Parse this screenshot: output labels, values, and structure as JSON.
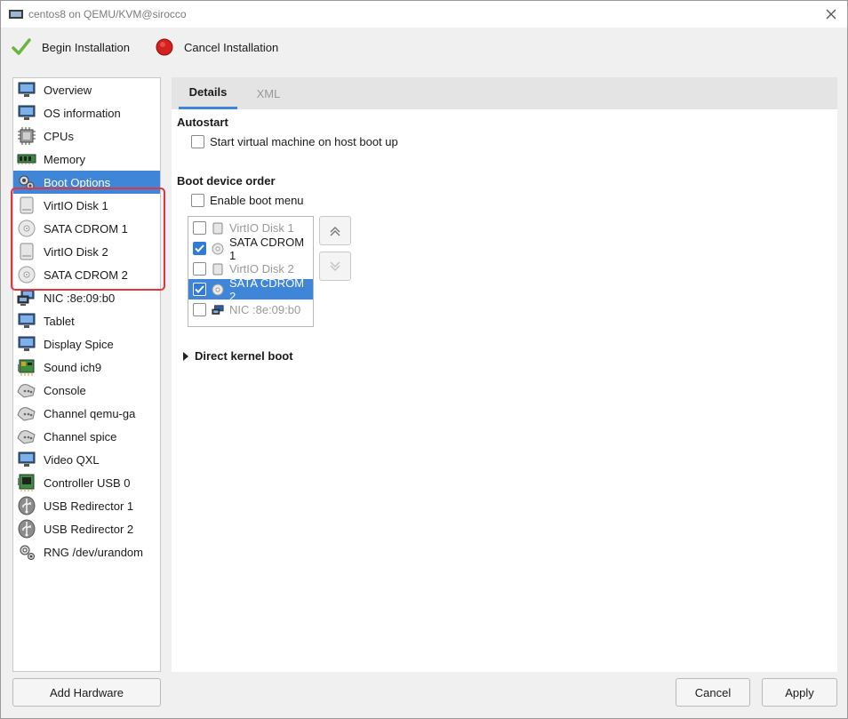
{
  "window": {
    "title": "centos8 on QEMU/KVM@sirocco"
  },
  "toolbar": {
    "begin_label": "Begin Installation",
    "cancel_label": "Cancel Installation"
  },
  "sidebar": {
    "items": [
      {
        "label": "Overview",
        "icon": "monitor-icon"
      },
      {
        "label": "OS information",
        "icon": "monitor-icon"
      },
      {
        "label": "CPUs",
        "icon": "cpu-icon"
      },
      {
        "label": "Memory",
        "icon": "memory-icon"
      },
      {
        "label": "Boot Options",
        "icon": "boot-options-icon"
      },
      {
        "label": "VirtIO Disk 1",
        "icon": "disk-icon"
      },
      {
        "label": "SATA CDROM 1",
        "icon": "cdrom-icon"
      },
      {
        "label": "VirtIO Disk 2",
        "icon": "disk-icon"
      },
      {
        "label": "SATA CDROM 2",
        "icon": "cdrom-icon"
      },
      {
        "label": "NIC :8e:09:b0",
        "icon": "network-icon"
      },
      {
        "label": "Tablet",
        "icon": "tablet-icon"
      },
      {
        "label": "Display Spice",
        "icon": "monitor-icon"
      },
      {
        "label": "Sound ich9",
        "icon": "sound-card-icon"
      },
      {
        "label": "Console",
        "icon": "serial-icon"
      },
      {
        "label": "Channel qemu-ga",
        "icon": "serial-icon"
      },
      {
        "label": "Channel spice",
        "icon": "serial-icon"
      },
      {
        "label": "Video QXL",
        "icon": "monitor-icon"
      },
      {
        "label": "Controller USB 0",
        "icon": "controller-icon"
      },
      {
        "label": "USB Redirector 1",
        "icon": "usb-icon"
      },
      {
        "label": "USB Redirector 2",
        "icon": "usb-icon"
      },
      {
        "label": "RNG /dev/urandom",
        "icon": "gear-icon"
      }
    ],
    "selected_index": 4
  },
  "tabs": {
    "details": "Details",
    "xml": "XML"
  },
  "autostart": {
    "title": "Autostart",
    "checkbox_label": "Start virtual machine on host boot up",
    "checked": false
  },
  "boot": {
    "title": "Boot device order",
    "menu_label": "Enable boot menu",
    "menu_checked": false,
    "devices": [
      {
        "label": "VirtIO Disk 1",
        "checked": false,
        "icon": "disk-icon"
      },
      {
        "label": "SATA CDROM 1",
        "checked": true,
        "icon": "cdrom-icon"
      },
      {
        "label": "VirtIO Disk 2",
        "checked": false,
        "icon": "disk-icon"
      },
      {
        "label": "SATA CDROM 2",
        "checked": true,
        "icon": "cdrom-icon"
      },
      {
        "label": "NIC :8e:09:b0",
        "checked": false,
        "icon": "network-icon"
      }
    ]
  },
  "kernel": {
    "title": "Direct kernel boot"
  },
  "buttons": {
    "add_hardware": "Add Hardware",
    "cancel": "Cancel",
    "apply": "Apply"
  },
  "colors": {
    "accent": "#3f86d9",
    "highlight": "#e0363f"
  }
}
